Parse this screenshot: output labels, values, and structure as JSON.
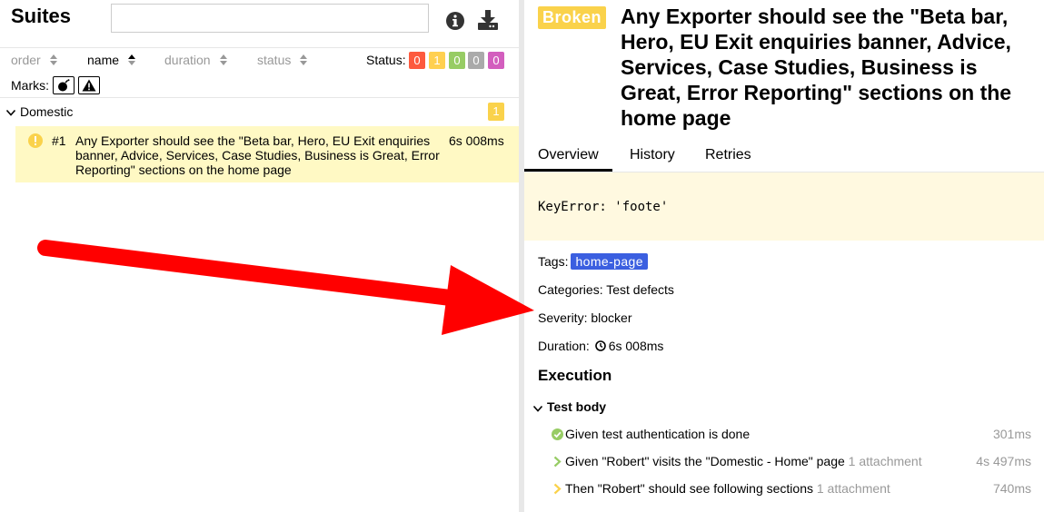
{
  "left": {
    "title": "Suites",
    "search": {
      "value": "",
      "placeholder": ""
    },
    "sort": {
      "order": "order",
      "name": "name",
      "duration": "duration",
      "status": "status"
    },
    "status_label": "Status:",
    "status_counts": [
      {
        "value": "0",
        "color": "#fd5a3e"
      },
      {
        "value": "1",
        "color": "#ffd050"
      },
      {
        "value": "0",
        "color": "#97cc64"
      },
      {
        "value": "0",
        "color": "#aaaaaa"
      },
      {
        "value": "0",
        "color": "#d35ebe"
      }
    ],
    "marks_label": "Marks:",
    "group": {
      "name": "Domestic",
      "count": "1"
    },
    "test": {
      "number": "#1",
      "name": "Any Exporter should see the \"Beta bar, Hero, EU Exit enquiries banner, Advice, Services, Case Studies, Business is Great, Error Reporting\" sections on the home page",
      "duration": "6s 008ms"
    }
  },
  "right": {
    "status_badge": "Broken",
    "title": "Any Exporter should see the \"Beta bar, Hero, EU Exit enquiries banner, Advice, Services, Case Studies, Business is Great, Error Reporting\" sections on the home page",
    "tabs": [
      "Overview",
      "History",
      "Retries"
    ],
    "error": "KeyError: 'foote'",
    "tags_label": "Tags:",
    "tag": "home-page",
    "categories": "Categories: Test defects",
    "severity": "Severity: blocker",
    "duration_label": "Duration:",
    "duration": "6s 008ms",
    "execution_title": "Execution",
    "test_body_label": "Test body",
    "steps": [
      {
        "name": "Given test authentication is done",
        "attachments": "",
        "duration": "301ms"
      },
      {
        "name": "Given \"Robert\" visits the \"Domestic - Home\" page",
        "attachments": "1 attachment",
        "duration": "4s 497ms"
      },
      {
        "name": "Then \"Robert\" should see following sections",
        "attachments": "1 attachment",
        "duration": "740ms"
      }
    ]
  },
  "colors": {
    "broken": "#fad24b",
    "selected_row": "#fff9c4",
    "error_bg": "#fff9e0",
    "tag": "#3b5fe0",
    "passed": "#97cc64",
    "annotation_arrow": "#ff0000"
  }
}
